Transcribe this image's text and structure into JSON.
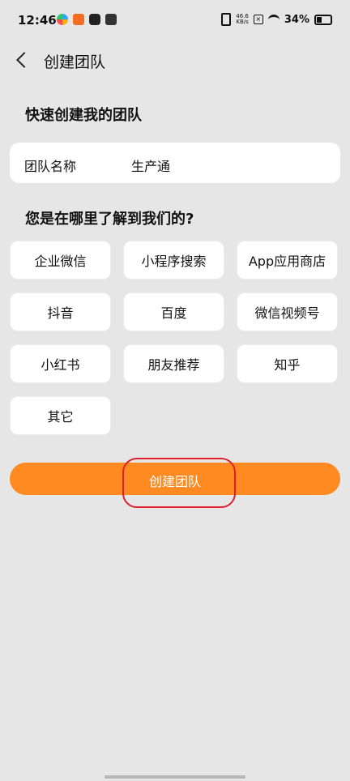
{
  "status": {
    "time": "12:46",
    "net_speed_top": "46.6",
    "net_speed_bottom": "KB/s",
    "battery": "34%"
  },
  "header": {
    "title": "创建团队"
  },
  "section1": {
    "title": "快速创建我的团队"
  },
  "team": {
    "label": "团队名称",
    "value": "生产通"
  },
  "section2": {
    "title": "您是在哪里了解到我们的?"
  },
  "options": [
    "企业微信",
    "小程序搜索",
    "App应用商店",
    "抖音",
    "百度",
    "微信视频号",
    "小红书",
    "朋友推荐",
    "知乎",
    "其它"
  ],
  "button": {
    "label": "创建团队"
  },
  "colors": {
    "accent": "#ff8a22",
    "annotation_red": "#e11f2b",
    "background": "#e6e6e6",
    "card": "#ffffff"
  }
}
